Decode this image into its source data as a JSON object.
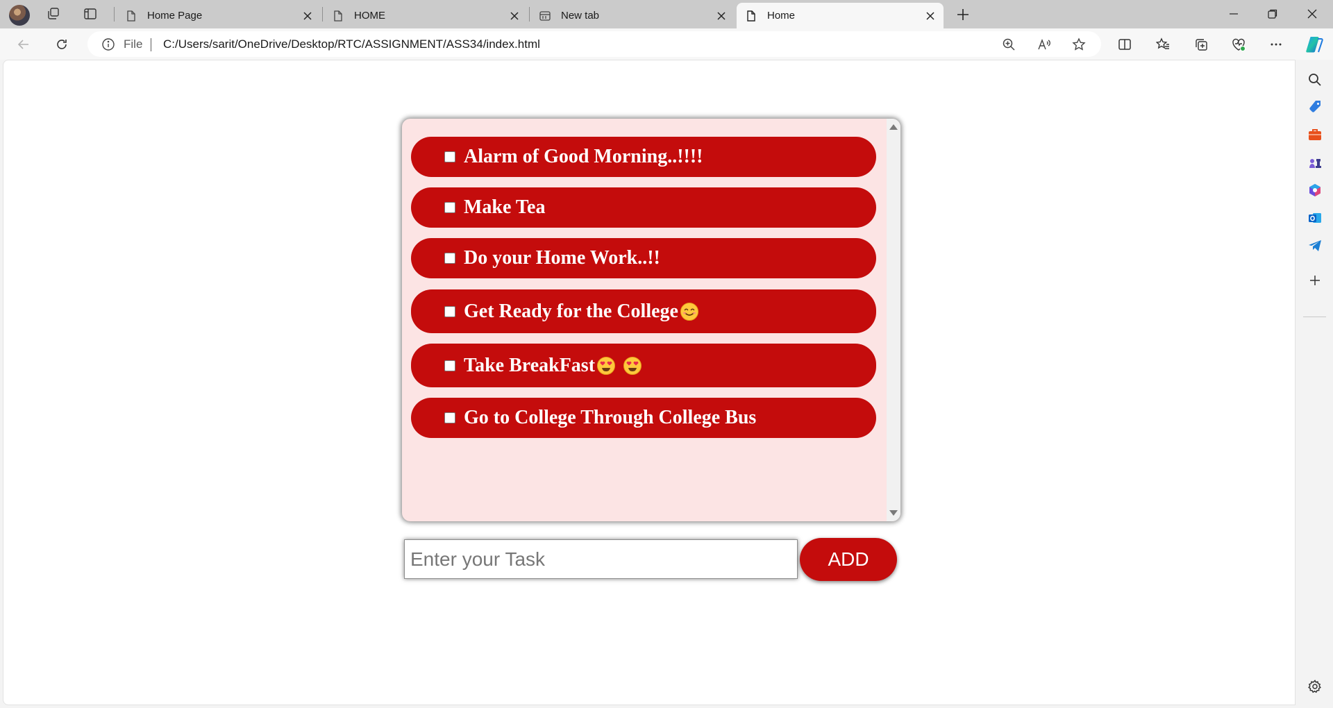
{
  "browser": {
    "tabs": [
      {
        "label": "Home Page",
        "active": false
      },
      {
        "label": "HOME",
        "active": false
      },
      {
        "label": "New tab",
        "active": false
      },
      {
        "label": "Home",
        "active": true
      }
    ],
    "address": {
      "scheme_label": "File",
      "url": "C:/Users/sarit/OneDrive/Desktop/RTC/ASSIGNMENT/ASS34/index.html"
    }
  },
  "todo": {
    "tasks": [
      {
        "label": "Alarm of Good Morning..!!!!",
        "checked": false,
        "emojis": []
      },
      {
        "label": "Make Tea",
        "checked": false,
        "emojis": []
      },
      {
        "label": "Do your Home Work..!!",
        "checked": false,
        "emojis": []
      },
      {
        "label": "Get Ready for the College",
        "checked": false,
        "emojis": [
          "smiling-face-emoji"
        ]
      },
      {
        "label": "Take BreakFast",
        "checked": false,
        "emojis": [
          "heart-eyes-emoji",
          "heart-eyes-emoji"
        ]
      },
      {
        "label": "Go to College Through College Bus",
        "checked": false,
        "emojis": []
      }
    ],
    "input_placeholder": "Enter your Task",
    "add_label": "ADD"
  },
  "colors": {
    "task_background": "#c40c0c",
    "list_background": "#fce4e4",
    "add_button": "#c40c0c"
  }
}
